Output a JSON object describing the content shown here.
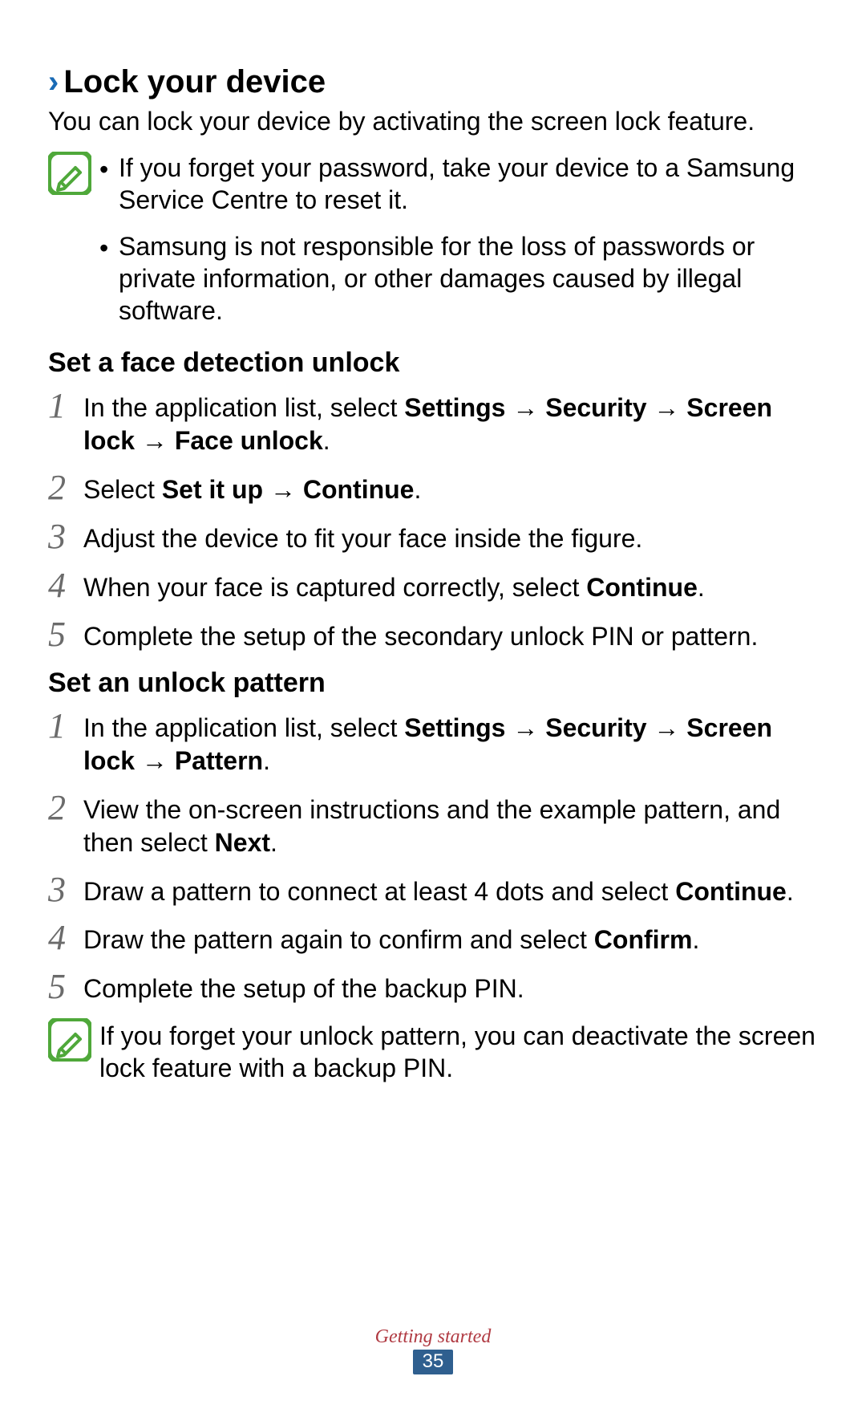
{
  "header": {
    "chevron": "›",
    "title": "Lock your device",
    "intro": "You can lock your device by activating the screen lock feature."
  },
  "note1": {
    "bullets": [
      "If you forget your password, take your device to a Samsung Service Centre to reset it.",
      "Samsung is not responsible for the loss of passwords or private information, or other damages caused by illegal software."
    ]
  },
  "section_face": {
    "heading": "Set a face detection unlock",
    "steps": [
      {
        "n": "1",
        "pre": "In the application list, select ",
        "bold": "Settings → Security → Screen lock → Face unlock",
        "post": "."
      },
      {
        "n": "2",
        "pre": "Select ",
        "bold": "Set it up → Continue",
        "post": "."
      },
      {
        "n": "3",
        "pre": "Adjust the device to fit your face inside the figure.",
        "bold": "",
        "post": ""
      },
      {
        "n": "4",
        "pre": "When your face is captured correctly, select ",
        "bold": "Continue",
        "post": "."
      },
      {
        "n": "5",
        "pre": "Complete the setup of the secondary unlock PIN or pattern.",
        "bold": "",
        "post": ""
      }
    ]
  },
  "section_pattern": {
    "heading": "Set an unlock pattern",
    "steps": [
      {
        "n": "1",
        "pre": "In the application list, select ",
        "bold": "Settings → Security → Screen lock → Pattern",
        "post": "."
      },
      {
        "n": "2",
        "pre": "View the on-screen instructions and the example pattern, and then select ",
        "bold": "Next",
        "post": "."
      },
      {
        "n": "3",
        "pre": "Draw a pattern to connect at least 4 dots and select ",
        "bold": "Continue",
        "post": "."
      },
      {
        "n": "4",
        "pre": "Draw the pattern again to confirm and select ",
        "bold": "Confirm",
        "post": "."
      },
      {
        "n": "5",
        "pre": "Complete the setup of the backup PIN.",
        "bold": "",
        "post": ""
      }
    ]
  },
  "note2": {
    "text": "If you forget your unlock pattern, you can deactivate the screen lock feature with a backup PIN."
  },
  "footer": {
    "section": "Getting started",
    "page": "35"
  }
}
